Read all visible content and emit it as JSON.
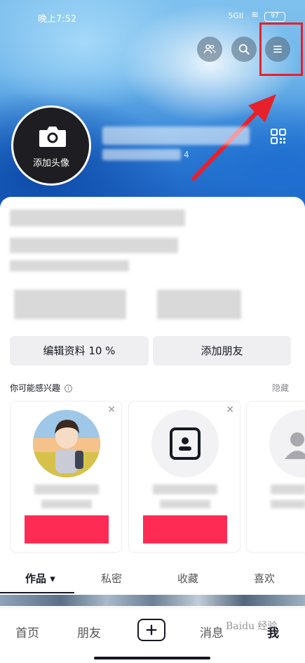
{
  "status_bar": {
    "time": "晚上7:52",
    "signal": "5Gll",
    "wifi": "≋",
    "battery": "97"
  },
  "header": {
    "avatar_label": "添加头像",
    "uid_tail": "4"
  },
  "actions": {
    "edit_profile": "编辑资料 10 %",
    "add_friend": "添加朋友"
  },
  "interest": {
    "title": "你可能感兴趣",
    "info": "i",
    "hide": "隐藏",
    "close": "✕"
  },
  "tabs": [
    {
      "label": "作品 ▾"
    },
    {
      "label": "私密"
    },
    {
      "label": "收藏"
    },
    {
      "label": "喜欢"
    }
  ],
  "nav": {
    "home": "首页",
    "friends": "朋友",
    "messages": "消息",
    "me": "我"
  },
  "watermark": "Baidu 经验",
  "colors": {
    "accent": "#fe2c55",
    "highlight": "#e8202a",
    "text": "#161823"
  }
}
